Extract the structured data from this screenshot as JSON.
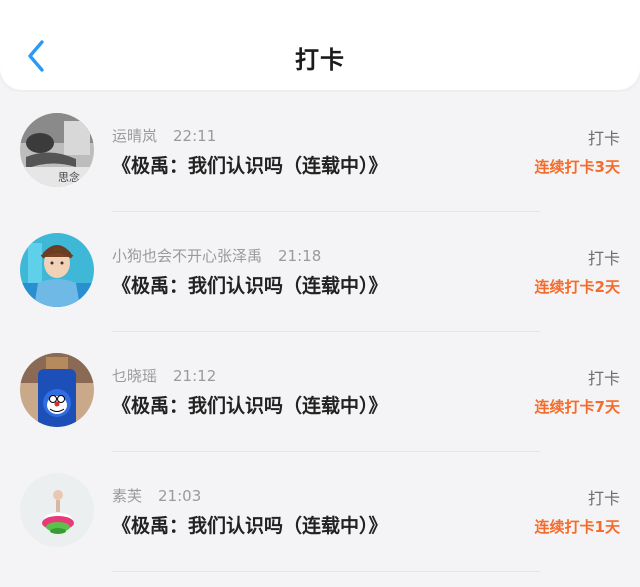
{
  "header": {
    "title": "打卡",
    "back_icon": "chevron-left-icon",
    "accent_color": "#2c9af5"
  },
  "records": [
    {
      "user": "运晴岚",
      "time": "22:11",
      "book": "《极禹：我们认识吗（连载中）》",
      "label": "打卡",
      "streak": "连续打卡3天",
      "avatar_text": "思念"
    },
    {
      "user": "小狗也会不开心张泽禹",
      "time": "21:18",
      "book": "《极禹：我们认识吗（连载中）》",
      "label": "打卡",
      "streak": "连续打卡2天"
    },
    {
      "user": "乜晓瑶",
      "time": "21:12",
      "book": "《极禹：我们认识吗（连载中）》",
      "label": "打卡",
      "streak": "连续打卡7天"
    },
    {
      "user": "素芙",
      "time": "21:03",
      "book": "《极禹：我们认识吗（连载中）》",
      "label": "打卡",
      "streak": "连续打卡1天"
    }
  ],
  "colors": {
    "streak": "#f56b2a",
    "username": "#9a9a9a",
    "book_title": "#222222"
  }
}
